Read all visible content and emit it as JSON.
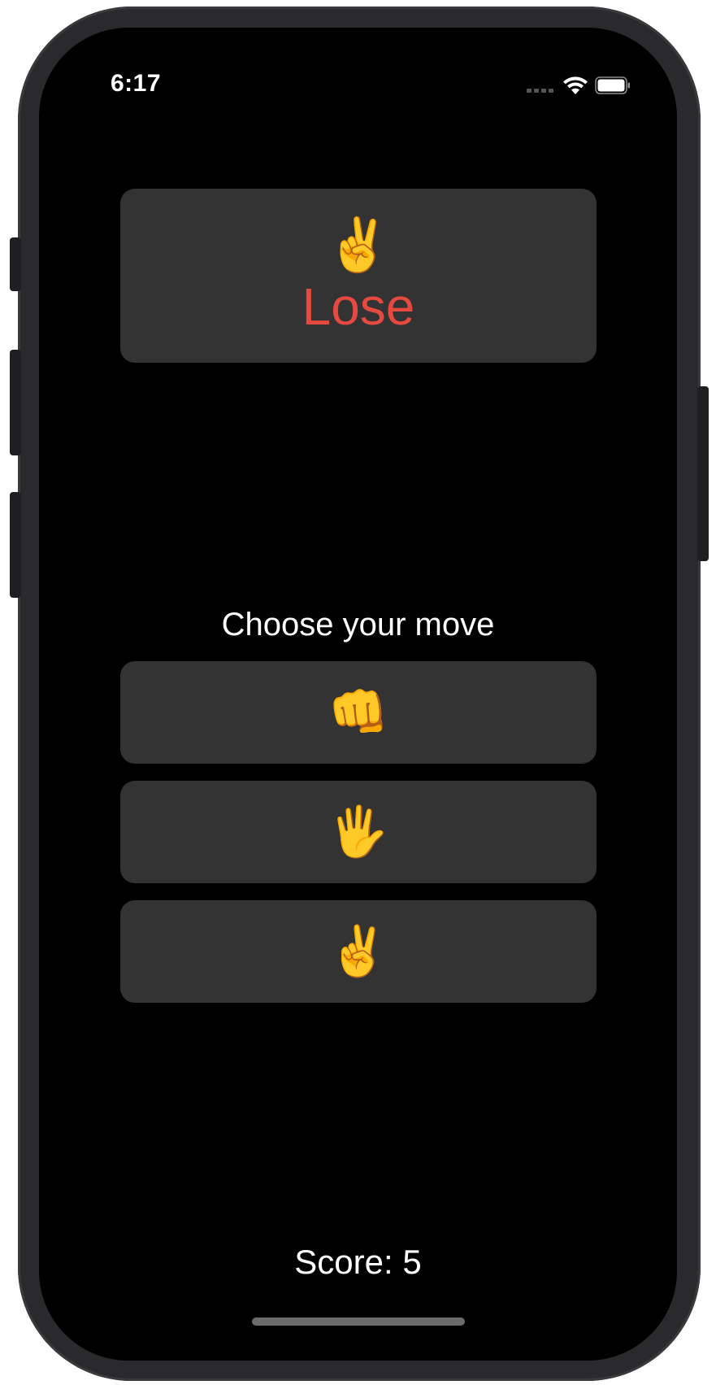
{
  "status_bar": {
    "time": "6:17",
    "wifi_icon": "wifi-icon",
    "battery_icon": "battery-icon",
    "signal_icon": "cellular-signal-icon"
  },
  "result": {
    "computer_move_emoji": "✌️",
    "outcome": "Lose",
    "outcome_color": "#e5493f"
  },
  "prompt": "Choose your move",
  "moves": [
    {
      "emoji": "👊",
      "name": "rock"
    },
    {
      "emoji": "🖐",
      "name": "paper"
    },
    {
      "emoji": "✌️",
      "name": "scissors"
    }
  ],
  "score_text": "Score: 5",
  "colors": {
    "background": "#000000",
    "card": "#333333",
    "text": "#ffffff"
  }
}
